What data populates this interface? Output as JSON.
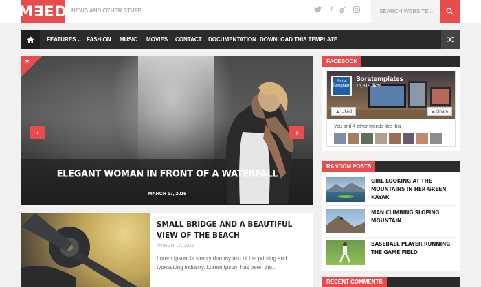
{
  "header": {
    "logo": "M∃ED",
    "tagline": "NEWS AND OTHER STUFF",
    "social_icons": [
      "twitter-icon",
      "facebook-icon",
      "google-plus-icon",
      "instagram-icon"
    ],
    "search_placeholder": "SEARCH WEBSITE ..."
  },
  "nav": {
    "items": [
      "FEATURES",
      "FASHION",
      "MUSIC",
      "MOVIES",
      "CONTACT",
      "DOCUMENTATION",
      "DOWNLOAD THIS TEMPLATE"
    ]
  },
  "slider": {
    "title": "ELEGANT WOMAN IN FRONT OF A WATERFALL",
    "date": "MARCH 17, 2016"
  },
  "post": {
    "title": "SMALL BRIDGE AND A BEAUTIFUL VIEW OF THE BEACH",
    "date": "MARCH 17, 2016",
    "excerpt": "Lorem Ipsum is simply dummy text of the printing and typesetting industry. Lorem Ipsum has been the..."
  },
  "sidebar": {
    "facebook": {
      "label": "FACEBOOK",
      "page_name": "Soratemplates",
      "likes": "15,819 likes",
      "avatar_text": "Sora Templates",
      "liked": "Liked",
      "share": "Share",
      "friends_text": "You and 4 other friends like this"
    },
    "random_posts": {
      "label": "RANDOM POSTS",
      "items": [
        "GIRL LOOKING AT THE MOUNTAINS IN HER GREEN KAYAK",
        "MAN CLIMBING SLOPING MOUNTAIN",
        "BASEBALL PLAYER RUNNING THE GAME FIELD"
      ]
    },
    "recent_comments": {
      "label": "RECENT COMMENTS"
    }
  },
  "colors": {
    "accent": "#e84c4c",
    "dark": "#2b2b2b",
    "background": "#f1f1f1"
  }
}
